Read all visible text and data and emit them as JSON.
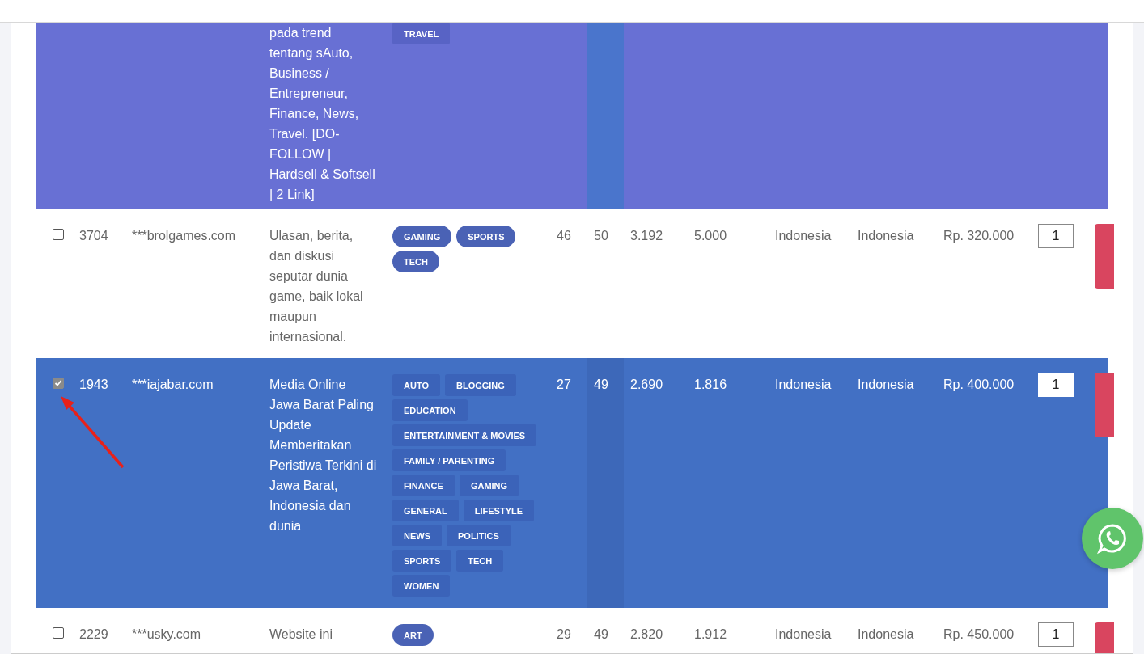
{
  "rows": [
    {
      "hovered": true,
      "description": "pada trend tentang sAuto, Business / Entrepreneur, Finance, News, Travel. [DO-FOLLOW | Hardsell & Softsell | 2 Link]",
      "tags": [
        "TRAVEL"
      ]
    },
    {
      "hovered": false,
      "checked": false,
      "id": "3704",
      "domain": "***brolgames.com",
      "description": "Ulasan, berita, dan diskusi seputar dunia game, baik lokal maupun internasional.",
      "tags": [
        "GAMING",
        "SPORTS",
        "TECH"
      ],
      "stats": [
        "46",
        "50",
        "3.192",
        "5.000"
      ],
      "column_9": "Indonesia",
      "column_10": "Indonesia",
      "price": "Rp. 320.000",
      "quantity": "1"
    },
    {
      "hovered": false,
      "checked": true,
      "id": "1943",
      "domain": "***iajabar.com",
      "description": "Media Online Jawa Barat Paling Update Memberitakan Peristiwa Terkini di Jawa Barat, Indonesia dan dunia",
      "tags": [
        "AUTO",
        "BLOGGING",
        "EDUCATION",
        "ENTERTAINMENT & MOVIES",
        "FAMILY / PARENTING",
        "FINANCE",
        "GAMING",
        "GENERAL",
        "LIFESTYLE",
        "NEWS",
        "POLITICS",
        "SPORTS",
        "TECH",
        "WOMEN"
      ],
      "stats": [
        "27",
        "49",
        "2.690",
        "1.816"
      ],
      "column_9": "Indonesia",
      "column_10": "Indonesia",
      "price": "Rp. 400.000",
      "quantity": "1"
    },
    {
      "hovered": false,
      "checked": false,
      "id": "2229",
      "domain": "***usky.com",
      "description": "Website ini",
      "tags": [
        "ART"
      ],
      "stats": [
        "29",
        "49",
        "2.820",
        "1.912"
      ],
      "column_9": "Indonesia",
      "column_10": "Indonesia",
      "price": "Rp. 450.000",
      "quantity": "1"
    }
  ]
}
